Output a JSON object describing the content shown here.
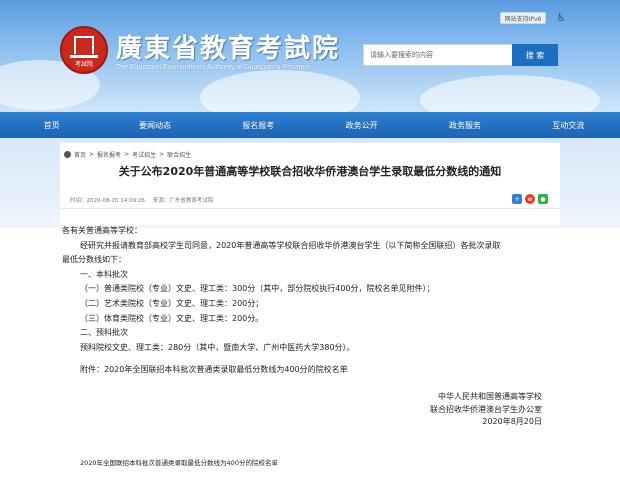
{
  "header": {
    "ipv6_label": "网站支持IPv6",
    "site_title": "廣東省教育考試院",
    "site_subtitle": "The Education Examinations Authority of Guangdong Province",
    "emblem_text": "考試院",
    "search_placeholder": "请输入要搜索的内容",
    "search_button": "搜 索"
  },
  "nav": {
    "items": [
      {
        "label": "首页"
      },
      {
        "label": "要闻动态"
      },
      {
        "label": "报名报考"
      },
      {
        "label": "政务公开"
      },
      {
        "label": "政务服务"
      },
      {
        "label": "互动交流"
      }
    ]
  },
  "breadcrumb": [
    "首页",
    "报名报考",
    "考试招生",
    "联合招生"
  ],
  "article": {
    "title": "关于公布2020年普通高等学校联合招收华侨港澳台学生录取最低分数线的通知",
    "time": "时间：2020-08-20 14:09:26",
    "source": "来源：广东省教育考试院"
  },
  "body": {
    "salutation": "各有关普通高等学校：",
    "intro_line1": "经研究并报请教育部高校学生司同意，2020年普通高等学校联合招收华侨港澳台学生（以下简称全国联招）各批次录取",
    "intro_line2": "最低分数线如下：",
    "sec1_title": "一、本科批次",
    "sec1_item1": "（一）普通类院校（专业）文史、理工类：300分（其中，部分院校执行400分，院校名单见附件）；",
    "sec1_item2": "（二）艺术类院校（专业）文史、理工类：200分；",
    "sec1_item3": "（三）体育类院校（专业）文史、理工类：200分。",
    "sec2_title": "二、预科批次",
    "sec2_item1": "预科院校文史、理工类：280分（其中，暨南大学、广州中医药大学380分）。",
    "attachment_note": "附件：2020年全国联招本科批次普通类录取最低分数线为400分的院校名单"
  },
  "signature": {
    "line1": "中华人民共和国普通高等学校",
    "line2": "联合招收华侨港澳台学生办公室",
    "date": "2020年8月20日"
  },
  "attachment_link": "2020年全国联招本科批次普通类录取最低分数线为400分的院校名单",
  "colors": {
    "nav_blue": "#1d63b3",
    "search_button": "#1c6fbf",
    "emblem_red": "#c8281e"
  }
}
